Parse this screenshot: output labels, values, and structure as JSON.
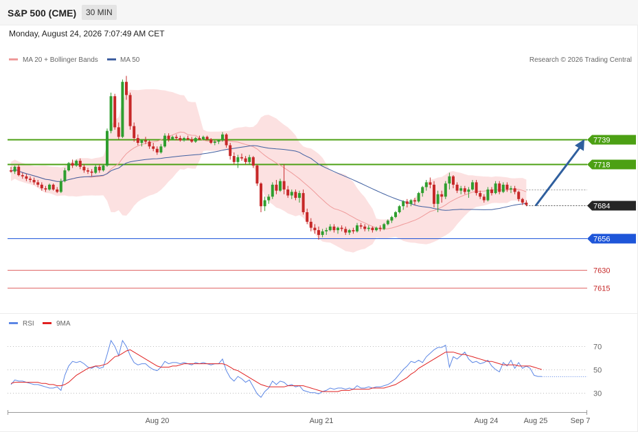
{
  "header": {
    "instrument": "S&P 500 (CME)",
    "timeframe": "30 MIN",
    "datetime": "Monday, August 24, 2026 7:07:49 AM CET"
  },
  "legend": {
    "ma20_label": "MA 20 + Bollinger Bands",
    "ma50_label": "MA 50",
    "copyright": "Research © 2026 Trading Central",
    "rsi_label": "RSI",
    "rsi9_label": "9MA"
  },
  "colors": {
    "up": "#2f9e2f",
    "down": "#c62828",
    "bollinger": "#f9c8c8",
    "ma20": "#ef9a9a",
    "ma50": "#3f5fa0",
    "resistance": "#4ca014",
    "support": "#1e56d9",
    "target": "#e06666",
    "arrow": "#2f5f9e",
    "rsi": "#5b86e5",
    "rsi9": "#e02020"
  },
  "chart_data": [
    {
      "type": "candlestick",
      "title": "S&P 500 (CME) 30 MIN",
      "y_range": [
        7597,
        7821
      ],
      "x_ticks": [
        "Aug 20",
        "Aug 21",
        "Aug 24",
        "Aug 25",
        "Sep 7"
      ],
      "levels": [
        {
          "value": 7739,
          "label": "7739",
          "kind": "resistance"
        },
        {
          "value": 7718,
          "label": "7718",
          "kind": "resistance"
        },
        {
          "value": 7684,
          "label": "7684",
          "kind": "last_price"
        },
        {
          "value": 7656,
          "label": "7656",
          "kind": "support"
        },
        {
          "value": 7630,
          "label": "7630",
          "kind": "target"
        },
        {
          "value": 7615,
          "label": "7615",
          "kind": "target"
        }
      ],
      "projection": {
        "from": 7684,
        "to": 7739,
        "direction": "up"
      },
      "candles": [
        [
          7713,
          7716,
          7711,
          7712
        ],
        [
          7712,
          7717,
          7710,
          7716
        ],
        [
          7716,
          7718,
          7708,
          7709
        ],
        [
          7709,
          7711,
          7706,
          7708
        ],
        [
          7708,
          7710,
          7704,
          7706
        ],
        [
          7706,
          7708,
          7703,
          7705
        ],
        [
          7705,
          7707,
          7701,
          7703
        ],
        [
          7703,
          7705,
          7699,
          7701
        ],
        [
          7701,
          7703,
          7696,
          7698
        ],
        [
          7698,
          7700,
          7695,
          7697
        ],
        [
          7697,
          7702,
          7696,
          7701
        ],
        [
          7701,
          7702,
          7696,
          7697
        ],
        [
          7697,
          7699,
          7694,
          7695
        ],
        [
          7695,
          7706,
          7694,
          7704
        ],
        [
          7704,
          7715,
          7703,
          7713
        ],
        [
          7713,
          7720,
          7712,
          7719
        ],
        [
          7719,
          7722,
          7715,
          7717
        ],
        [
          7717,
          7722,
          7716,
          7721
        ],
        [
          7721,
          7723,
          7714,
          7716
        ],
        [
          7716,
          7718,
          7711,
          7713
        ],
        [
          7713,
          7715,
          7710,
          7712
        ],
        [
          7712,
          7714,
          7708,
          7711
        ],
        [
          7711,
          7718,
          7710,
          7716
        ],
        [
          7716,
          7718,
          7711,
          7713
        ],
        [
          7713,
          7718,
          7712,
          7717
        ],
        [
          7717,
          7748,
          7716,
          7746
        ],
        [
          7746,
          7778,
          7744,
          7775
        ],
        [
          7775,
          7777,
          7747,
          7749
        ],
        [
          7749,
          7753,
          7739,
          7741
        ],
        [
          7741,
          7789,
          7740,
          7787
        ],
        [
          7787,
          7792,
          7772,
          7776
        ],
        [
          7776,
          7778,
          7747,
          7750
        ],
        [
          7750,
          7753,
          7737,
          7740
        ],
        [
          7740,
          7743,
          7734,
          7736
        ],
        [
          7736,
          7739,
          7733,
          7738
        ],
        [
          7738,
          7741,
          7735,
          7737
        ],
        [
          7737,
          7738,
          7731,
          7733
        ],
        [
          7733,
          7736,
          7729,
          7731
        ],
        [
          7731,
          7733,
          7726,
          7728
        ],
        [
          7728,
          7735,
          7727,
          7733
        ],
        [
          7733,
          7744,
          7732,
          7742
        ],
        [
          7742,
          7744,
          7737,
          7739
        ],
        [
          7739,
          7742,
          7738,
          7741
        ],
        [
          7741,
          7743,
          7738,
          7740
        ],
        [
          7740,
          7742,
          7737,
          7738
        ],
        [
          7738,
          7741,
          7737,
          7740
        ],
        [
          7740,
          7742,
          7738,
          7739
        ],
        [
          7739,
          7741,
          7736,
          7737
        ],
        [
          7737,
          7741,
          7736,
          7740
        ],
        [
          7740,
          7742,
          7738,
          7739
        ],
        [
          7739,
          7742,
          7738,
          7741
        ],
        [
          7741,
          7742,
          7738,
          7739
        ],
        [
          7739,
          7740,
          7735,
          7736
        ],
        [
          7736,
          7738,
          7734,
          7737
        ],
        [
          7737,
          7739,
          7735,
          7738
        ],
        [
          7738,
          7745,
          7737,
          7743
        ],
        [
          7743,
          7744,
          7732,
          7734
        ],
        [
          7734,
          7736,
          7722,
          7725
        ],
        [
          7725,
          7728,
          7718,
          7720
        ],
        [
          7720,
          7726,
          7715,
          7724
        ],
        [
          7724,
          7727,
          7721,
          7723
        ],
        [
          7723,
          7725,
          7718,
          7720
        ],
        [
          7720,
          7726,
          7718,
          7724
        ],
        [
          7724,
          7725,
          7715,
          7717
        ],
        [
          7717,
          7718,
          7700,
          7702
        ],
        [
          7702,
          7703,
          7678,
          7683
        ],
        [
          7683,
          7691,
          7679,
          7688
        ],
        [
          7688,
          7693,
          7685,
          7691
        ],
        [
          7691,
          7703,
          7689,
          7701
        ],
        [
          7701,
          7705,
          7693,
          7696
        ],
        [
          7696,
          7706,
          7695,
          7704
        ],
        [
          7704,
          7718,
          7693,
          7697
        ],
        [
          7697,
          7700,
          7690,
          7692
        ],
        [
          7692,
          7697,
          7689,
          7695
        ],
        [
          7695,
          7697,
          7688,
          7690
        ],
        [
          7690,
          7696,
          7686,
          7694
        ],
        [
          7694,
          7697,
          7676,
          7678
        ],
        [
          7678,
          7681,
          7668,
          7670
        ],
        [
          7670,
          7673,
          7662,
          7665
        ],
        [
          7665,
          7668,
          7660,
          7663
        ],
        [
          7663,
          7666,
          7655,
          7659
        ],
        [
          7659,
          7664,
          7657,
          7662
        ],
        [
          7662,
          7665,
          7659,
          7663
        ],
        [
          7663,
          7668,
          7662,
          7666
        ],
        [
          7666,
          7668,
          7661,
          7663
        ],
        [
          7663,
          7666,
          7660,
          7665
        ],
        [
          7665,
          7667,
          7662,
          7664
        ],
        [
          7664,
          7666,
          7659,
          7661
        ],
        [
          7661,
          7664,
          7659,
          7663
        ],
        [
          7663,
          7665,
          7660,
          7662
        ],
        [
          7662,
          7669,
          7661,
          7667
        ],
        [
          7667,
          7669,
          7664,
          7666
        ],
        [
          7666,
          7668,
          7662,
          7664
        ],
        [
          7664,
          7667,
          7662,
          7665
        ],
        [
          7665,
          7666,
          7661,
          7663
        ],
        [
          7663,
          7666,
          7662,
          7665
        ],
        [
          7665,
          7667,
          7662,
          7664
        ],
        [
          7664,
          7669,
          7663,
          7668
        ],
        [
          7668,
          7672,
          7667,
          7671
        ],
        [
          7671,
          7675,
          7669,
          7674
        ],
        [
          7674,
          7679,
          7673,
          7678
        ],
        [
          7678,
          7684,
          7677,
          7683
        ],
        [
          7683,
          7688,
          7680,
          7687
        ],
        [
          7687,
          7689,
          7682,
          7685
        ],
        [
          7685,
          7689,
          7683,
          7688
        ],
        [
          7688,
          7690,
          7684,
          7687
        ],
        [
          7687,
          7695,
          7686,
          7694
        ],
        [
          7694,
          7700,
          7691,
          7699
        ],
        [
          7699,
          7705,
          7696,
          7703
        ],
        [
          7703,
          7707,
          7698,
          7701
        ],
        [
          7701,
          7704,
          7682,
          7685
        ],
        [
          7685,
          7696,
          7678,
          7693
        ],
        [
          7693,
          7696,
          7686,
          7691
        ],
        [
          7691,
          7704,
          7689,
          7702
        ],
        [
          7702,
          7711,
          7697,
          7708
        ],
        [
          7708,
          7709,
          7698,
          7701
        ],
        [
          7701,
          7703,
          7694,
          7696
        ],
        [
          7696,
          7700,
          7693,
          7698
        ],
        [
          7698,
          7700,
          7693,
          7695
        ],
        [
          7695,
          7699,
          7690,
          7697
        ],
        [
          7697,
          7705,
          7696,
          7703
        ],
        [
          7703,
          7705,
          7692,
          7694
        ],
        [
          7694,
          7696,
          7689,
          7691
        ],
        [
          7691,
          7693,
          7686,
          7688
        ],
        [
          7688,
          7699,
          7687,
          7697
        ],
        [
          7697,
          7699,
          7692,
          7694
        ],
        [
          7694,
          7704,
          7693,
          7702
        ],
        [
          7702,
          7704,
          7693,
          7695
        ],
        [
          7695,
          7703,
          7694,
          7701
        ],
        [
          7701,
          7703,
          7695,
          7697
        ],
        [
          7697,
          7700,
          7694,
          7698
        ],
        [
          7698,
          7700,
          7693,
          7695
        ],
        [
          7695,
          7696,
          7687,
          7689
        ],
        [
          7689,
          7690,
          7684,
          7686
        ],
        [
          7686,
          7688,
          7683,
          7684
        ]
      ]
    },
    {
      "type": "line",
      "title": "RSI",
      "y_ticks": [
        30,
        50,
        70
      ],
      "y_range": [
        18,
        82
      ],
      "series": [
        {
          "name": "RSI",
          "values": [
            37,
            41,
            40,
            40,
            39,
            38,
            37,
            37,
            36,
            35,
            34,
            34,
            35,
            32,
            45,
            53,
            57,
            56,
            57,
            55,
            52,
            51,
            53,
            51,
            52,
            63,
            75,
            70,
            62,
            75,
            70,
            62,
            56,
            54,
            55,
            55,
            52,
            50,
            49,
            52,
            57,
            55,
            56,
            56,
            55,
            56,
            55,
            54,
            56,
            55,
            56,
            55,
            54,
            55,
            55,
            59,
            49,
            43,
            40,
            44,
            42,
            39,
            41,
            35,
            29,
            26,
            31,
            34,
            40,
            37,
            40,
            39,
            36,
            37,
            35,
            36,
            32,
            31,
            30,
            30,
            29,
            31,
            32,
            34,
            33,
            34,
            34,
            33,
            34,
            33,
            36,
            34,
            34,
            35,
            34,
            35,
            35,
            36,
            37,
            39,
            42,
            46,
            50,
            53,
            57,
            56,
            58,
            56,
            61,
            64,
            67,
            69,
            69,
            71,
            52,
            61,
            59,
            62,
            65,
            59,
            56,
            57,
            55,
            56,
            58,
            53,
            50,
            48,
            56,
            53,
            58,
            51,
            56,
            51,
            53,
            51,
            45,
            44,
            44
          ]
        },
        {
          "name": "9MA",
          "values": [
            38,
            39,
            39,
            39,
            39,
            39,
            39,
            39,
            38,
            38,
            37,
            37,
            36,
            36,
            37,
            39,
            42,
            45,
            47,
            49,
            51,
            52,
            53,
            53,
            54,
            55,
            58,
            61,
            62,
            64,
            66,
            67,
            65,
            63,
            61,
            59,
            57,
            55,
            53,
            52,
            52,
            52,
            53,
            53,
            54,
            55,
            55,
            55,
            55,
            55,
            55,
            55,
            55,
            55,
            55,
            55,
            54,
            52,
            50,
            49,
            47,
            45,
            43,
            41,
            39,
            37,
            36,
            35,
            35,
            35,
            35,
            35,
            36,
            36,
            36,
            36,
            36,
            35,
            34,
            33,
            32,
            31,
            31,
            31,
            31,
            31,
            32,
            32,
            32,
            33,
            33,
            33,
            33,
            33,
            34,
            34,
            34,
            34,
            35,
            36,
            37,
            39,
            41,
            43,
            46,
            48,
            51,
            53,
            55,
            57,
            59,
            61,
            63,
            65,
            65,
            65,
            64,
            63,
            63,
            62,
            61,
            60,
            59,
            58,
            57,
            57,
            56,
            55,
            54,
            54,
            54,
            54,
            53,
            53,
            53,
            53,
            52,
            51,
            50
          ]
        }
      ]
    }
  ]
}
